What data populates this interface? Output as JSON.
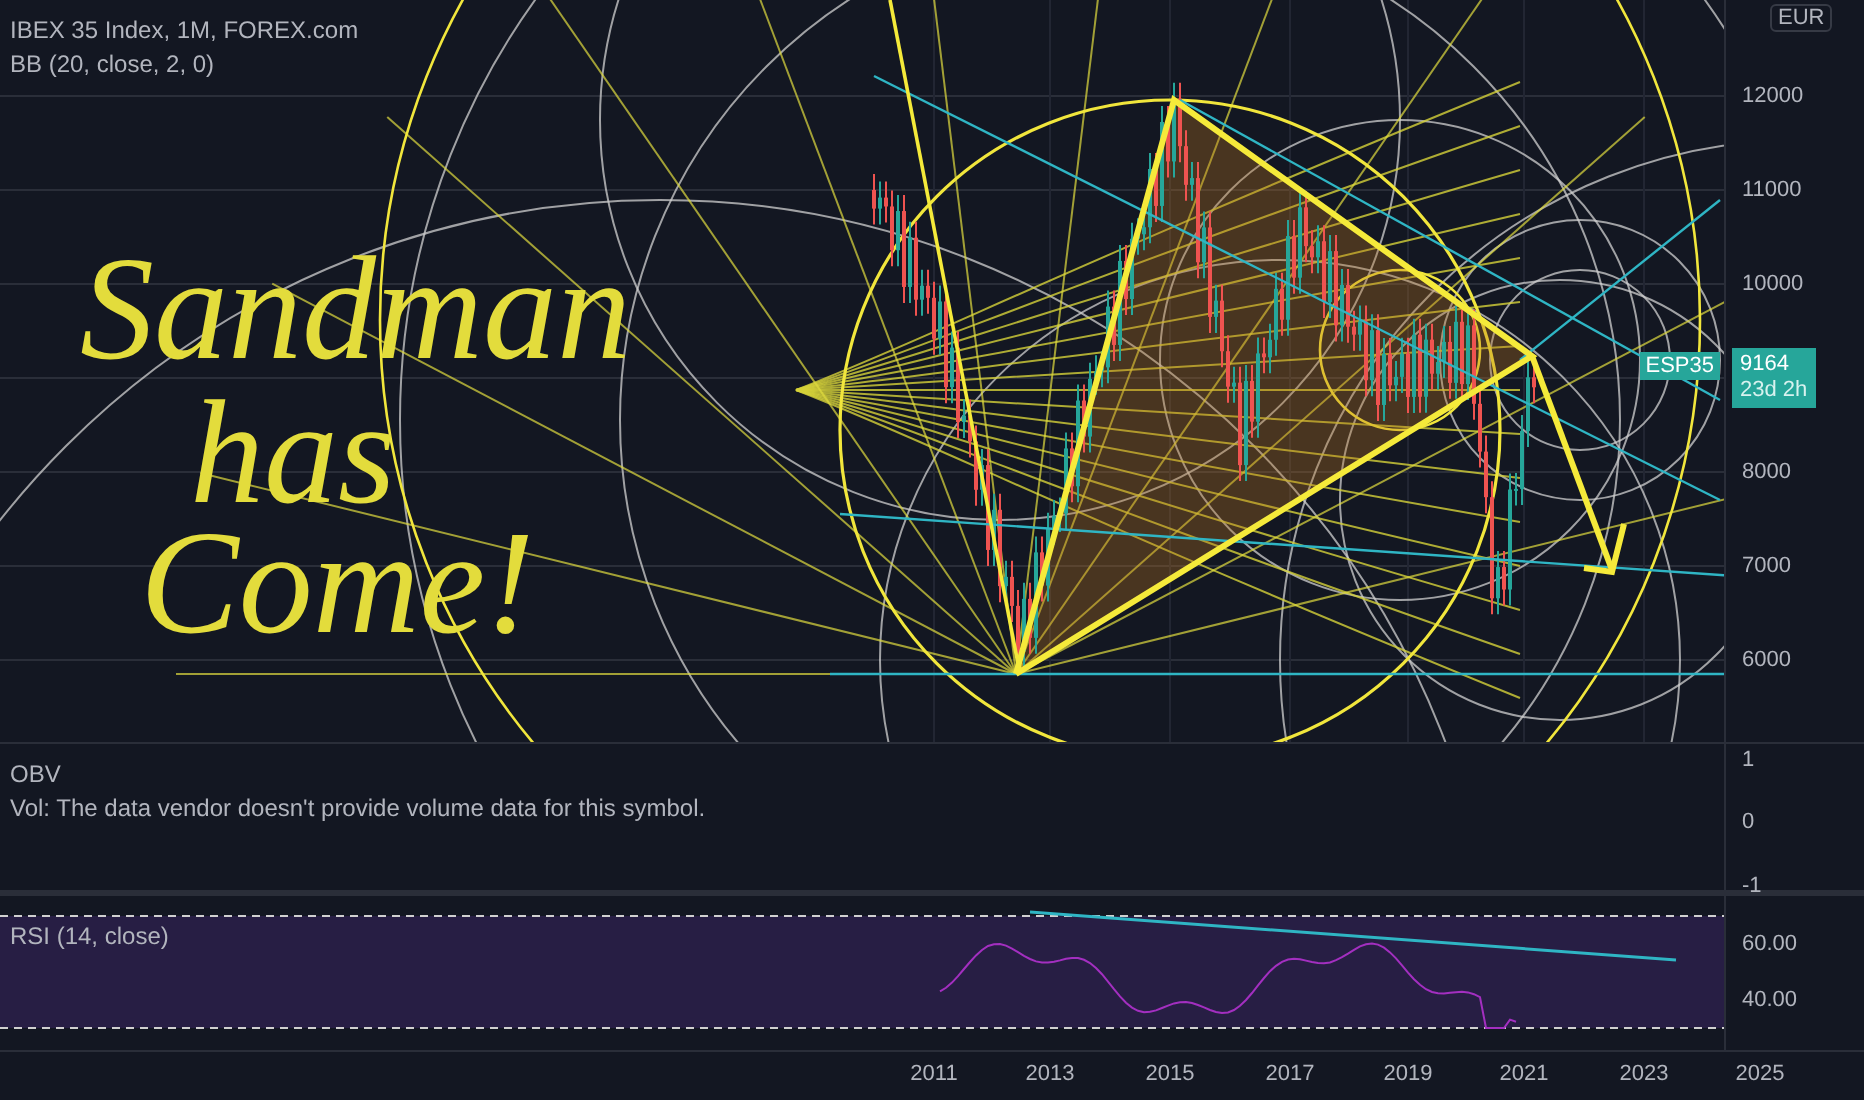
{
  "chart": {
    "title": "IBEX 35 Index, 1M, FOREX.com",
    "indicator": "BB (20, close, 2, 0)",
    "handwriting": [
      "Sandman",
      "has",
      "Come!"
    ],
    "price_axis": {
      "currency": "EUR",
      "ticks": [
        "12000",
        "11000",
        "10000",
        "8000",
        "7000",
        "6000"
      ]
    },
    "symbol_badge": "ESP35",
    "price_badge": {
      "price": "9164",
      "countdown": "23d 2h"
    }
  },
  "obv_pane": {
    "title": "OBV",
    "message": "Vol: The data vendor doesn't provide volume data for this symbol.",
    "ticks": [
      "1",
      "0",
      "-1"
    ]
  },
  "rsi_pane": {
    "title": "RSI (14, close)",
    "ticks": [
      "60.00",
      "40.00"
    ]
  },
  "time_axis": {
    "ticks": [
      "2011",
      "2013",
      "2015",
      "2017",
      "2019",
      "2021",
      "2023",
      "2025"
    ]
  }
}
